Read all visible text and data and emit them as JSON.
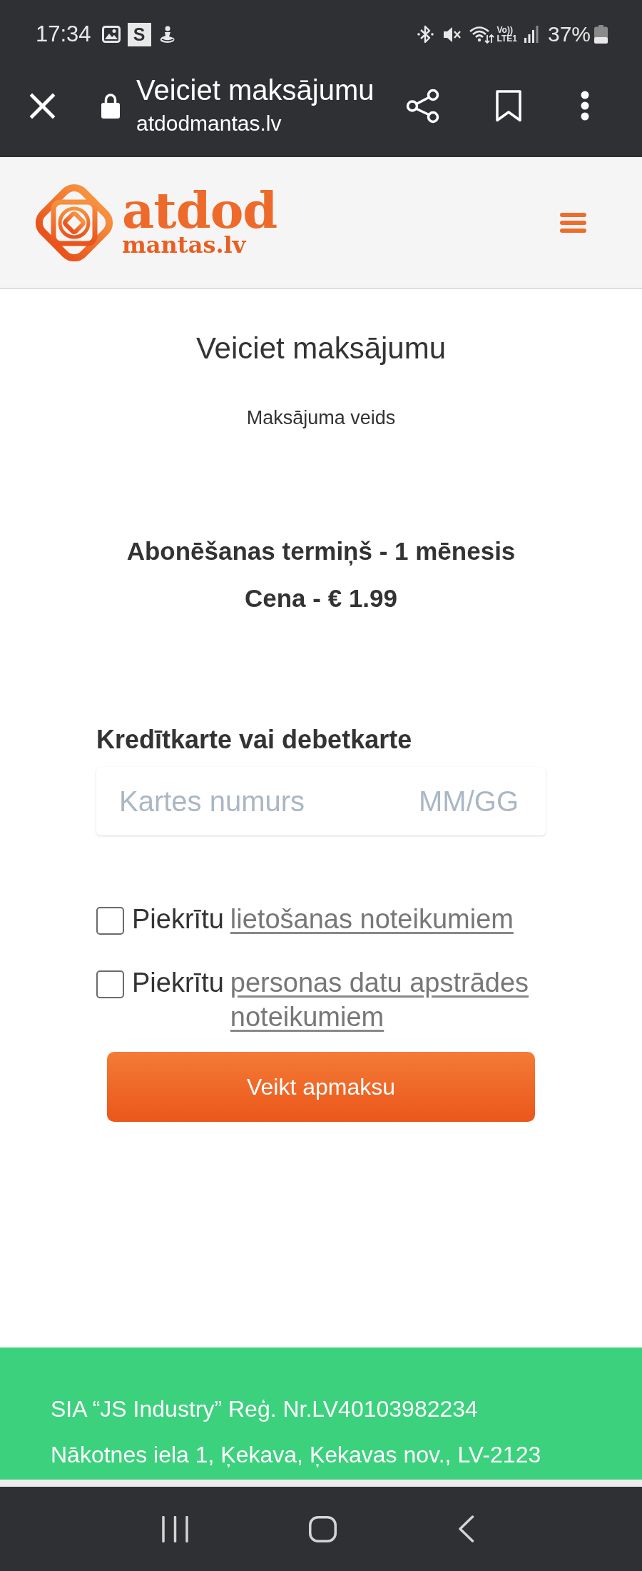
{
  "status_bar": {
    "time": "17:34",
    "notification_badge": "S",
    "network_top": "Vo))",
    "network_bottom": "LTE1",
    "battery": "37%"
  },
  "browser_bar": {
    "title": "Veiciet maksājumu",
    "url": "atdodmantas.lv"
  },
  "site_header": {
    "logo": {
      "line_1": "atdod",
      "line_2": "mantas.lv"
    }
  },
  "page": {
    "title": "Veiciet maksājumu",
    "subtitle": "Maksājuma veids",
    "plan": "Abonēšanas termiņš - 1 mēnesis",
    "price": "Cena - € 1.99"
  },
  "card_form": {
    "heading": "Kredītkarte vai debetkarte",
    "card_number": {
      "placeholder": "Kartes numurs"
    },
    "expiry": {
      "placeholder": "MM/GG"
    }
  },
  "agreements": [
    {
      "label": "Piekrītu",
      "link": "lietošanas noteikumiem",
      "checked": false
    },
    {
      "label": "Piekrītu",
      "link": "personas datu apstrādes noteikumiem",
      "checked": false
    }
  ],
  "pay_button": "Veikt apmaksu",
  "footer": {
    "lines": [
      "SIA “JS Industry” Reģ. Nr.LV40103982234",
      "Nākotnes iela 1, Ķekava, Ķekavas nov., LV-2123"
    ]
  }
}
